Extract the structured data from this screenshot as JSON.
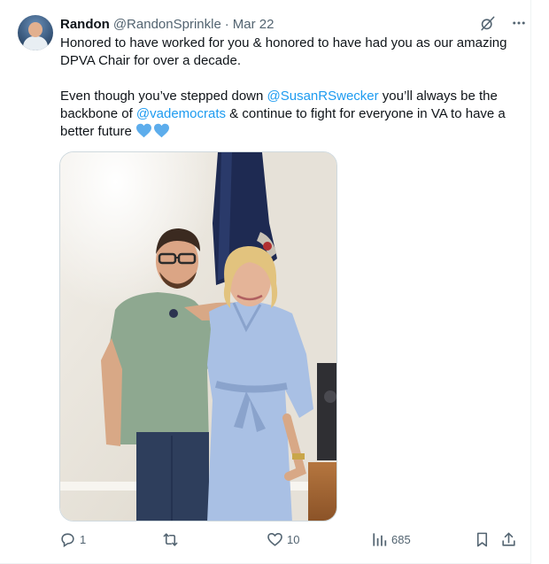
{
  "tweet": {
    "author_name": "Randon",
    "author_handle": "@RandonSprinkle",
    "separator": "·",
    "date": "Mar 22",
    "text_line1": "Honored to have worked for you & honored to have had you as our amazing DPVA Chair for over a decade.",
    "text_p2_before": "Even though you’ve stepped down ",
    "mention1": "@SusanRSwecker",
    "text_p2_mid": " you’ll always be the backbone of ",
    "mention2": "@vademocrats",
    "text_p2_after": " & continue to fight for everyone in VA to have a better future"
  },
  "actions": {
    "replies": "1",
    "reposts": "",
    "likes": "10",
    "views": "685"
  },
  "icons": {
    "top": [
      "grok-slash-icon",
      "more-icon"
    ],
    "actions": [
      "reply-icon",
      "repost-icon",
      "like-icon",
      "views-icon",
      "bookmark-icon",
      "share-icon"
    ]
  },
  "colors": {
    "accent": "#1d9bf0",
    "secondary_text": "#536471",
    "heart_emoji": "#5dadec"
  }
}
